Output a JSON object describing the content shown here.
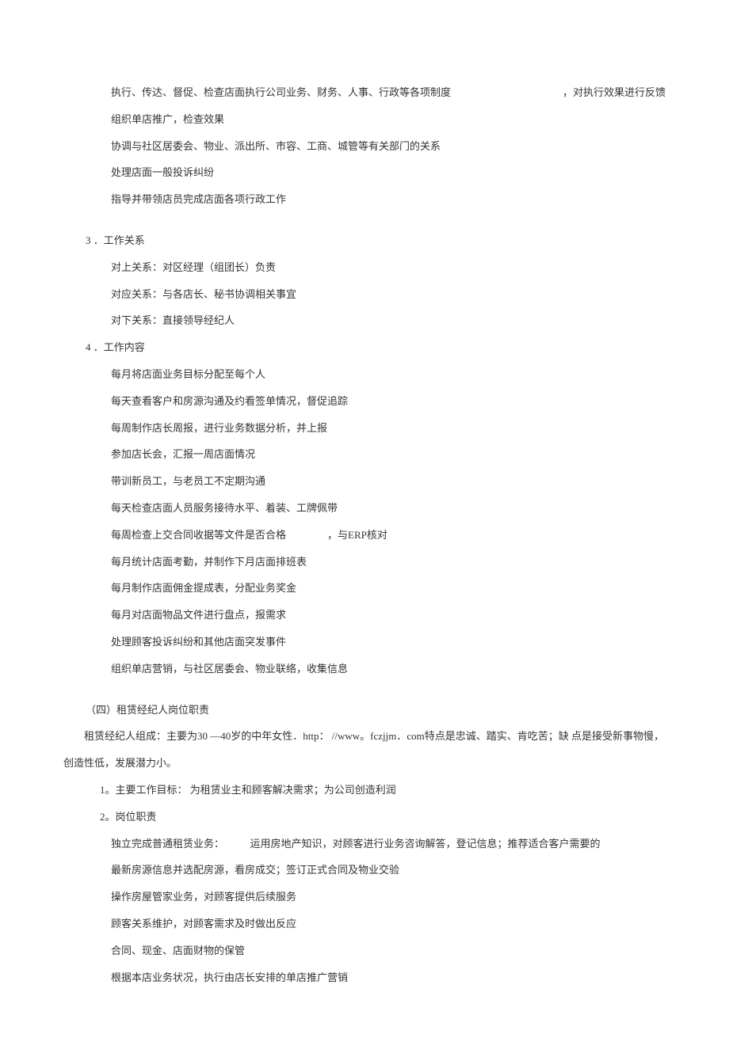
{
  "lines": [
    {
      "class": "indent-1",
      "text": "执行、传达、督促、检查店面执行公司业务、财务、人事、行政等各项制度",
      "right": "，对执行效果进行反馈"
    },
    {
      "class": "indent-1",
      "text": "组织单店推广，检查效果"
    },
    {
      "class": "indent-1",
      "text": "协调与社区居委会、物业、派出所、市容、工商、城管等有关部门的关系"
    },
    {
      "class": "indent-1",
      "text": "处理店面一般投诉纠纷"
    },
    {
      "class": "indent-1",
      "text": "指导并带领店员完成店面各项行政工作"
    }
  ],
  "section3": {
    "title": "3  ．工作关系",
    "items": [
      "对上关系：对区经理（组团长）负责",
      "对应关系：与各店长、秘书协调相关事宜",
      "对下关系：直接领导经纪人"
    ]
  },
  "section4": {
    "title": "4  ．工作内容",
    "items": [
      "每月将店面业务目标分配至每个人",
      "每天查看客户和房源沟通及约看签单情况，督促追踪",
      "每周制作店长周报，进行业务数据分析，并上报",
      "参加店长会，汇报一周店面情况",
      "带训新员工，与老员工不定期沟通",
      "每天检查店面人员服务接待水平、着装、工牌佩带",
      "每周检查上交合同收据等文件是否合格　　　　，与ERP核对",
      "每月统计店面考勤，并制作下月店面排班表",
      "每月制作店面佣金提成表，分配业务奖金",
      "每月对店面物品文件进行盘点，报需求",
      "处理顾客投诉纠纷和其他店面突发事件",
      "组织单店营销，与社区居委会、物业联络，收集信息"
    ]
  },
  "section_si": {
    "title": "（四）租赁经纪人岗位职责",
    "body": "租赁经纪人组成：主要为30 —40岁的中年女性．http：  //www。fczjjm．com特点是忠诚、踏实、肯吃苦；缺  点是接受新事物慢，创造性低，发展潜力小。",
    "item1": "1。主要工作目标：  为租赁业主和顾客解决需求；为公司创造利润",
    "item2_title": "2。岗位职责",
    "item2_list": [
      "独立完成普通租赁业务：　　　运用房地产知识，对顾客进行业务咨询解答，登记信息；推荐适合客户需要的",
      "最新房源信息并选配房源，看房成交；签订正式合同及物业交验",
      "操作房屋管家业务，对顾客提供后续服务",
      "顾客关系维护，对顾客需求及时做出反应",
      "合同、现金、店面财物的保管",
      "根据本店业务状况，执行由店长安排的单店推广营销"
    ]
  }
}
